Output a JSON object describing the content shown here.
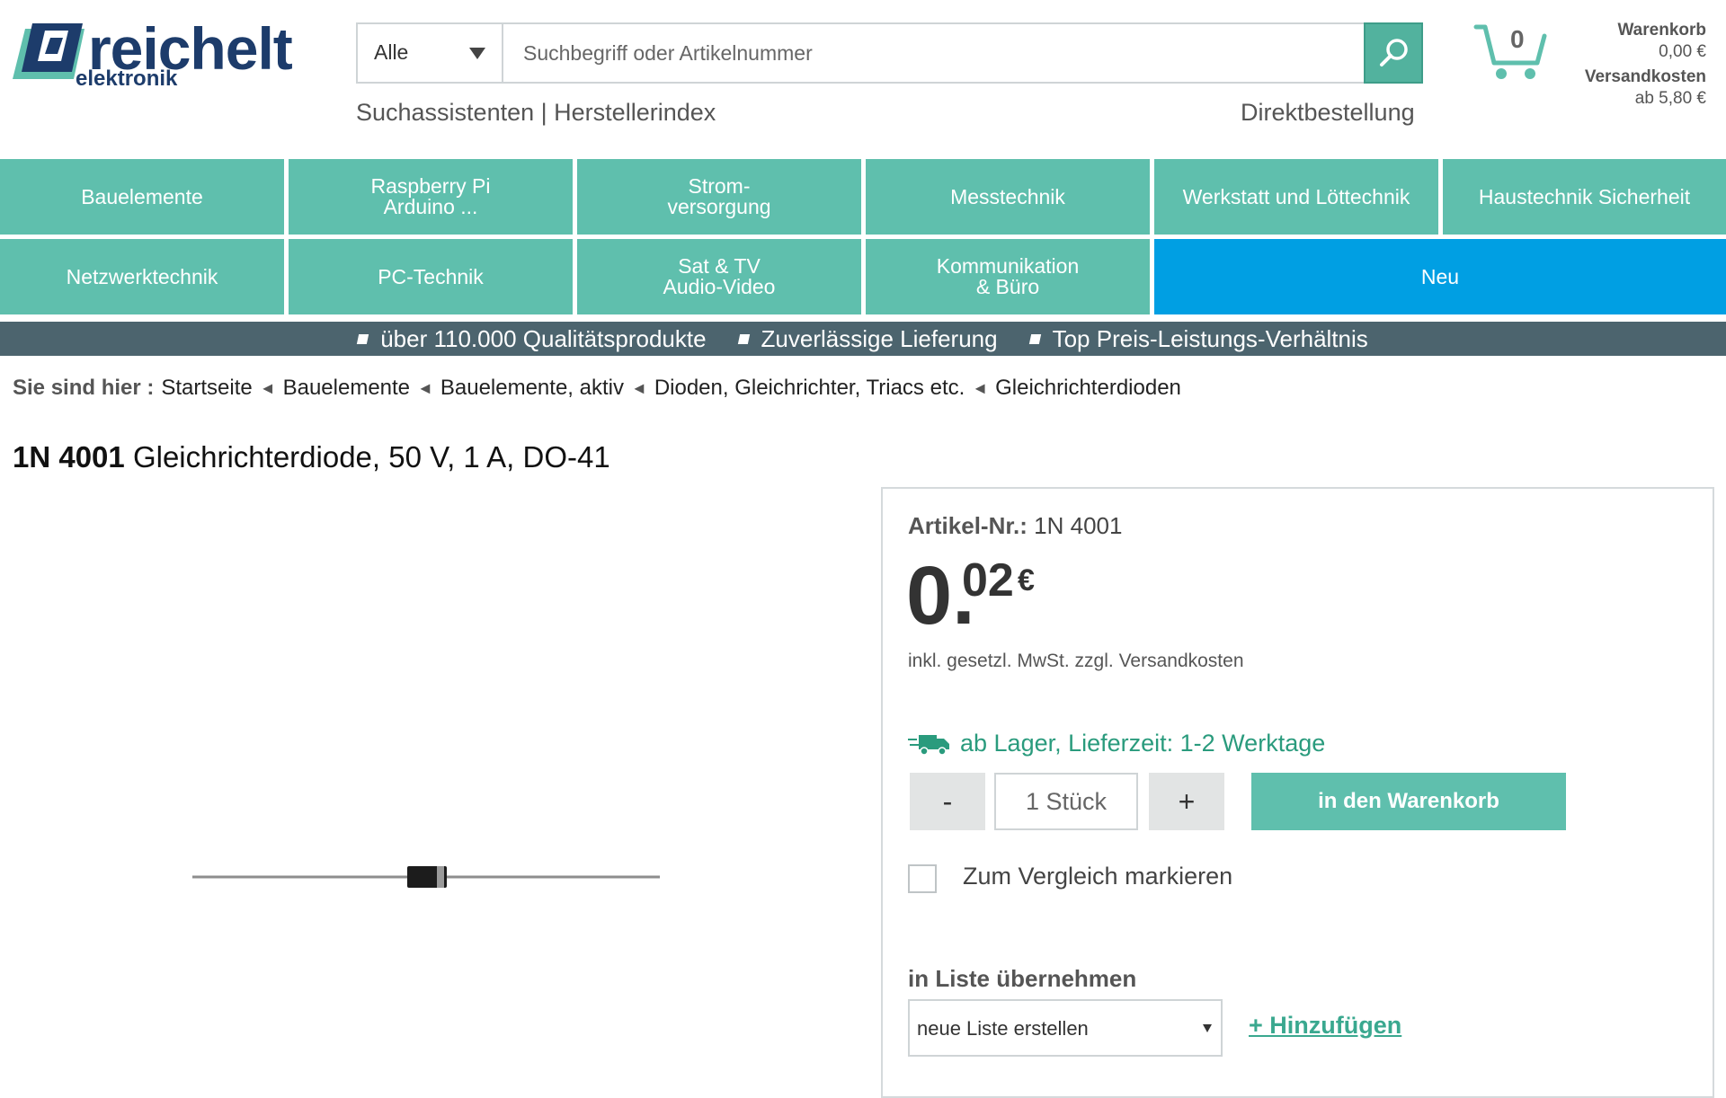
{
  "header": {
    "logo_text": "reichelt",
    "logo_sub": "elektronik",
    "search_category": "Alle",
    "search_placeholder": "Suchbegriff oder Artikelnummer",
    "link_assistants": "Suchassistenten",
    "link_divider": "|",
    "link_manufacturers": "Herstellerindex",
    "link_direct_order": "Direktbestellung",
    "cart_count": "0",
    "cart_label": "Warenkorb",
    "cart_total": "0,00 €",
    "shipping_label": "Versandkosten",
    "shipping_value": "ab 5,80 €"
  },
  "categories": [
    "Bauelemente",
    "Raspberry Pi\nArduino ...",
    "Strom-\nversorgung",
    "Messtechnik",
    "Werkstatt und Löttechnik",
    "Haustechnik Sicherheit",
    "Netzwerktechnik",
    "PC-Technik",
    "Sat & TV\nAudio-Video",
    "Kommunikation\n& Büro",
    "Neu"
  ],
  "usp": [
    "über 110.000 Qualitätsprodukte",
    "Zuverlässige Lieferung",
    "Top Preis-Leistungs-Verhältnis"
  ],
  "breadcrumb": {
    "lead": "Sie sind hier :",
    "items": [
      "Startseite",
      "Bauelemente",
      "Bauelemente, aktiv",
      "Dioden, Gleichrichter, Triacs etc.",
      "Gleichrichterdioden"
    ]
  },
  "product": {
    "title_bold": "1N 4001",
    "title_rest": "Gleichrichterdiode, 50 V, 1 A, DO-41",
    "artnr_label": "Artikel-Nr.:",
    "artnr_value": "1N 4001",
    "price_int": "0.",
    "price_dec": "02",
    "price_currency": "€",
    "vat_note": "inkl. gesetzl. MwSt. zzgl. Versandkosten",
    "stock": "ab Lager, Lieferzeit: 1-2 Werktage",
    "qty_minus": "-",
    "qty_value": "1 Stück",
    "qty_plus": "+",
    "add_to_cart": "in den Warenkorb",
    "compare_label": "Zum Vergleich markieren",
    "list_title": "in Liste übernehmen",
    "list_select": "neue Liste erstellen",
    "list_add": "+ Hinzufügen"
  },
  "colors": {
    "category_bg": "#5fbfad",
    "new_bg": "#009fe3",
    "usp_bar": "#4c646e",
    "stock_green": "#2a9b7d"
  }
}
